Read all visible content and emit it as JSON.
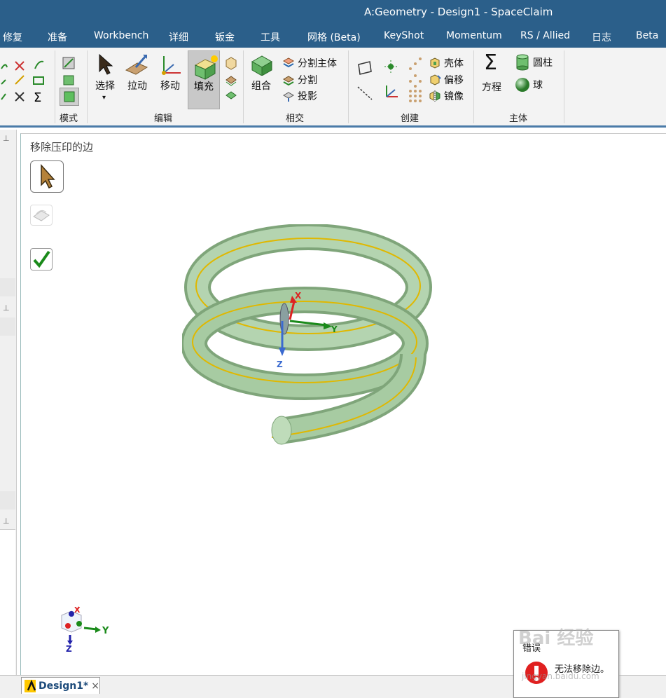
{
  "window": {
    "title": "A:Geometry - Design1 - SpaceClaim"
  },
  "menu": [
    "修复",
    "准备",
    "Workbench",
    "详细",
    "钣金",
    "工具",
    "网格 (Beta)",
    "KeyShot",
    "Momentum",
    "RS / Allied",
    "日志",
    "Beta"
  ],
  "ribbon": {
    "mode": {
      "label": "模式"
    },
    "edit": {
      "label": "编辑",
      "select": "选择",
      "pull": "拉动",
      "move": "移动",
      "fill": "填充"
    },
    "intersect": {
      "label": "相交",
      "combine": "组合",
      "split_body": "分割主体",
      "split": "分割",
      "project": "投影"
    },
    "create": {
      "label": "创建",
      "shell": "壳体",
      "offset": "偏移",
      "mirror": "镜像"
    },
    "body": {
      "label": "主体",
      "equation": "方程",
      "cylinder": "圆柱",
      "sphere": "球"
    }
  },
  "tool_guide": {
    "title": "移除压印的边"
  },
  "triad": {
    "x": "X",
    "y": "Y",
    "z": "Z"
  },
  "view_cube": {
    "x": "X",
    "y": "Y",
    "z": "Z"
  },
  "doc_tab": {
    "label": "Design1*",
    "close": "×"
  },
  "error": {
    "title": "错误",
    "message": "无法移除边。"
  },
  "watermark": {
    "text": "Bai 经验",
    "url": "jingyan.baidu.com"
  },
  "colors": {
    "title_bar": "#2b5f8a",
    "spring": "#a7cba2",
    "edge": "#e0b800"
  }
}
